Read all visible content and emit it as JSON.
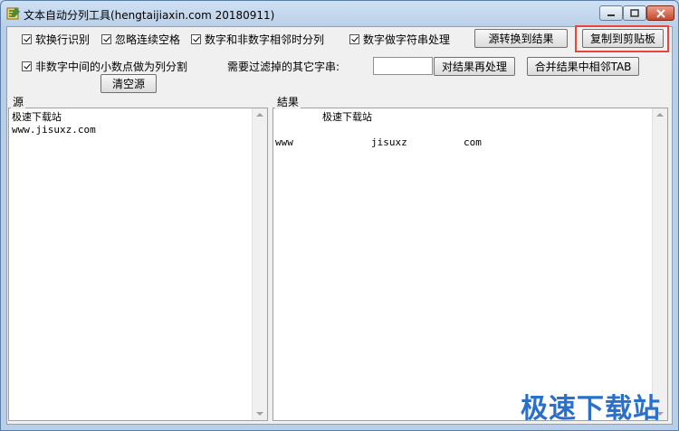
{
  "window": {
    "title": "文本自动分列工具(hengtaijiaxin.com 20180911)"
  },
  "options": {
    "soft_wrap": "软换行识别",
    "ignore_spaces": "忽略连续空格",
    "split_digit_nondigit": "数字和非数字相邻时分列",
    "digits_as_string": "数字做字符串处理",
    "decimal_point_split": "非数字中间的小数点做为列分割"
  },
  "filter": {
    "label": "需要过滤掉的其它字串:",
    "value": ""
  },
  "buttons": {
    "source_to_result": "源转换到结果",
    "copy_to_clipboard": "复制到剪贴板",
    "reprocess_result": "对结果再处理",
    "merge_tab": "合并结果中相邻TAB",
    "clear_source": "清空源"
  },
  "source_panel": {
    "label": "源",
    "lines": [
      "极速下载站",
      "www.jisuxz.com"
    ]
  },
  "result_panel": {
    "label": "結果",
    "line1": "极速下载站",
    "cells": [
      "www",
      "jisuxz",
      "com"
    ]
  },
  "watermark": "极速下载站",
  "colors": {
    "highlight": "#e8463a",
    "watermark": "#2a6fc9"
  }
}
